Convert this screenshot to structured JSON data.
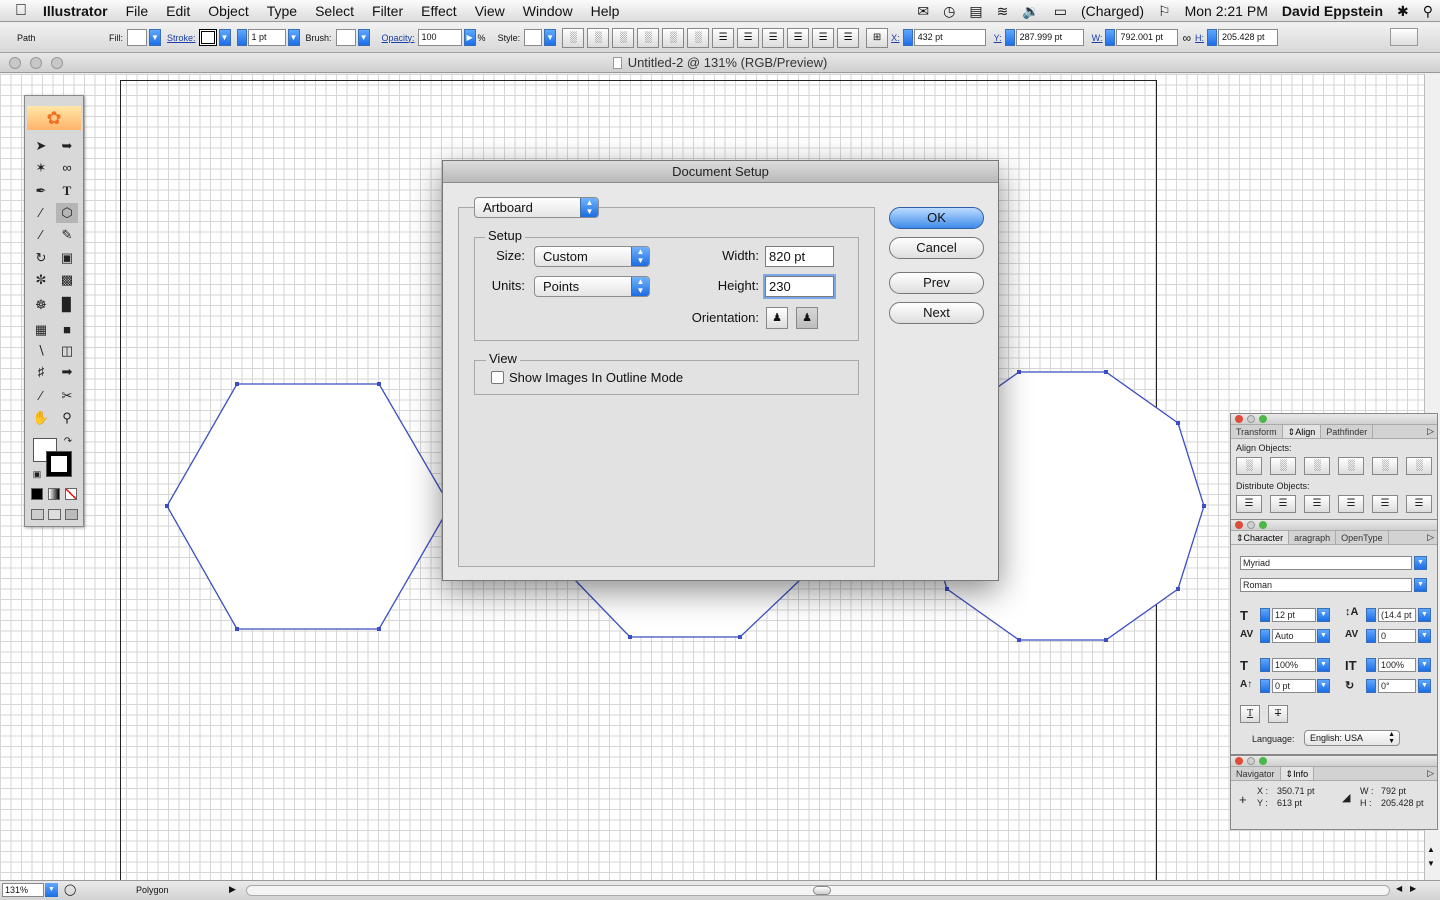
{
  "menubar": {
    "app": "Illustrator",
    "items": [
      "File",
      "Edit",
      "Object",
      "Type",
      "Select",
      "Filter",
      "Effect",
      "View",
      "Window",
      "Help"
    ],
    "battery": "(Charged)",
    "clock": "Mon 2:21 PM",
    "user": "David Eppstein"
  },
  "controlbar": {
    "selection": "Path",
    "fill_label": "Fill:",
    "stroke_label": "Stroke:",
    "stroke_weight": "1 pt",
    "brush_label": "Brush:",
    "opacity_label": "Opacity:",
    "opacity_value": "100",
    "opacity_unit": "%",
    "style_label": "Style:",
    "x_label": "X:",
    "x_value": "432 pt",
    "y_label": "Y:",
    "y_value": "287.999 pt",
    "w_label": "W:",
    "w_value": "792.001 pt",
    "h_label": "H:",
    "h_value": "205.428 pt"
  },
  "document": {
    "title": "Untitled-2 @ 131% (RGB/Preview)"
  },
  "dialog": {
    "title": "Document Setup",
    "section_popup": "Artboard",
    "setup_label": "Setup",
    "size_label": "Size:",
    "size_value": "Custom",
    "units_label": "Units:",
    "units_value": "Points",
    "width_label": "Width:",
    "width_value": "820 pt",
    "height_label": "Height:",
    "height_value": "230",
    "orientation_label": "Orientation:",
    "view_label": "View",
    "outline_checkbox_label": "Show Images In Outline Mode",
    "buttons": {
      "ok": "OK",
      "cancel": "Cancel",
      "prev": "Prev",
      "next": "Next"
    }
  },
  "align_panel": {
    "tabs": [
      "Transform",
      "Align",
      "Pathfinder"
    ],
    "align_objects_label": "Align Objects:",
    "distribute_objects_label": "Distribute Objects:"
  },
  "character_panel": {
    "tabs": [
      "Character",
      "aragraph",
      "OpenType"
    ],
    "font_family": "Myriad",
    "font_style": "Roman",
    "font_size": "12 pt",
    "leading": "(14.4 pt",
    "kerning": "Auto",
    "tracking": "0",
    "vertical_scale": "100%",
    "horizontal_scale": "100%",
    "baseline_shift": "0 pt",
    "rotation": "0°",
    "language_label": "Language:",
    "language_value": "English: USA"
  },
  "info_panel": {
    "tabs": [
      "Navigator",
      "Info"
    ],
    "x_label": "X :",
    "x_value": "350.71 pt",
    "y_label": "Y :",
    "y_value": "613 pt",
    "w_label": "W :",
    "w_value": "792 pt",
    "h_label": "H :",
    "h_value": "205.428 pt"
  },
  "statusbar": {
    "zoom": "131%",
    "tool": "Polygon"
  },
  "colors": {
    "path_stroke": "#3b4fc2",
    "accent_blue": "#1d6ce0"
  }
}
